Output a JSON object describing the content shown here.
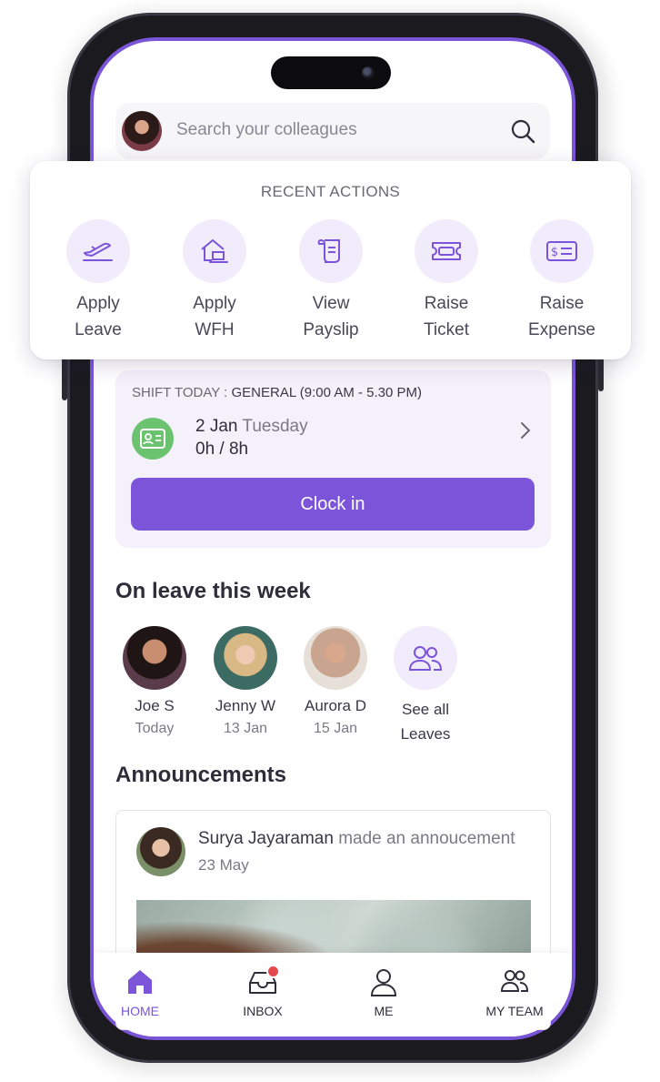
{
  "search": {
    "placeholder": "Search your colleagues"
  },
  "recent_actions": {
    "title": "RECENT ACTIONS",
    "items": [
      {
        "label": "Apply\nLeave",
        "icon": "plane-takeoff-icon"
      },
      {
        "label": "Apply\nWFH",
        "icon": "home-laptop-icon"
      },
      {
        "label": "View\nPayslip",
        "icon": "scroll-icon"
      },
      {
        "label": "Raise\nTicket",
        "icon": "ticket-icon"
      },
      {
        "label": "Raise\nExpense",
        "icon": "cash-icon"
      }
    ]
  },
  "shift": {
    "label": "SHIFT TODAY :",
    "name": "GENERAL (9:00 AM - 5.30 PM)",
    "date": "2 Jan",
    "day": "Tuesday",
    "hours": "0h / 8h",
    "clock_in_label": "Clock in"
  },
  "on_leave": {
    "title": "On leave this week",
    "people": [
      {
        "name": "Joe S",
        "when": "Today"
      },
      {
        "name": "Jenny W",
        "when": "13 Jan"
      },
      {
        "name": "Aurora D",
        "when": "15 Jan"
      }
    ],
    "see_all": "See all\nLeaves"
  },
  "announcements": {
    "title": "Announcements",
    "author": "Surya Jayaraman",
    "action": "made an annoucement",
    "date": "23 May"
  },
  "nav": {
    "home": "HOME",
    "inbox": "INBOX",
    "me": "ME",
    "my_team": "MY TEAM"
  },
  "colors": {
    "accent": "#7b54d9",
    "accent_soft": "#f1ecfb",
    "success": "#6cc36f",
    "notification": "#e5484d"
  }
}
